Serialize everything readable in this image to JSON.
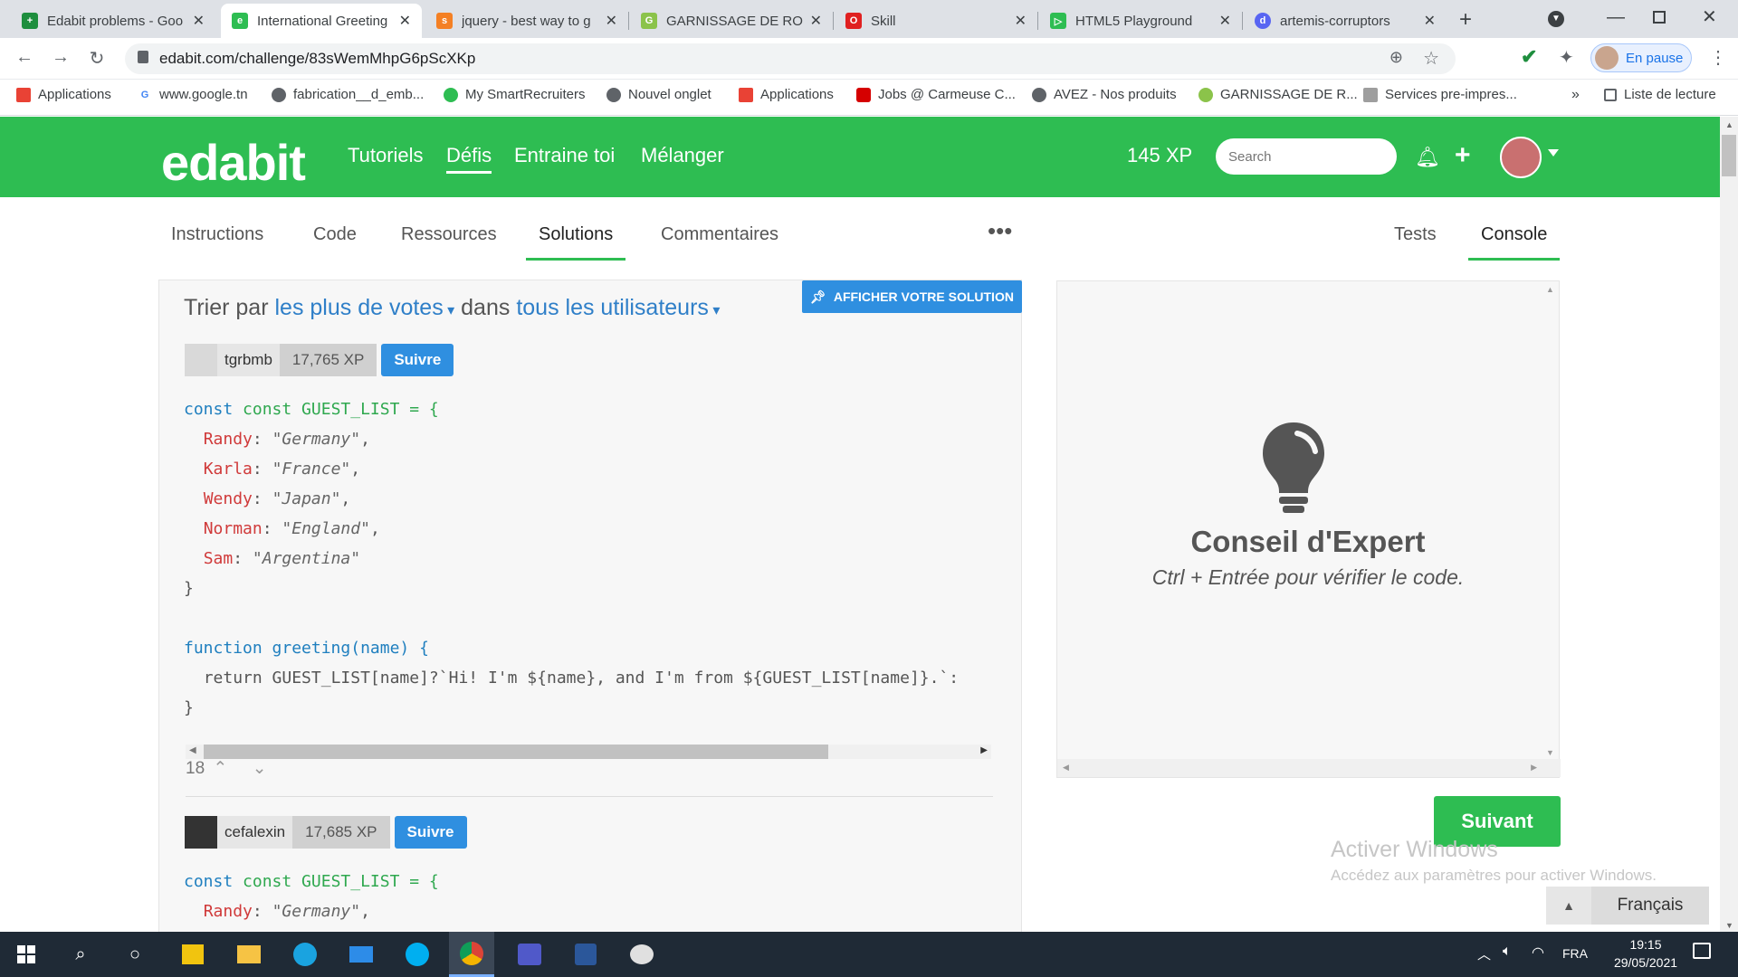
{
  "browser": {
    "tabs": [
      {
        "label": "Edabit problems - Goo",
        "favicon": "sheets-icon",
        "color": "#1e8e3e"
      },
      {
        "label": "International Greeting",
        "favicon": "edabit-icon",
        "color": "#2ebd52"
      },
      {
        "label": "jquery - best way to g",
        "favicon": "stackoverflow-icon",
        "color": "#f48024"
      },
      {
        "label": "GARNISSAGE DE ROU",
        "favicon": "garnissage-icon",
        "color": "#8bc34a"
      },
      {
        "label": "Skill",
        "favicon": "skill-icon",
        "color": "#e02020"
      },
      {
        "label": "HTML5 Playground",
        "favicon": "playground-icon",
        "color": "#2ebd52"
      },
      {
        "label": "artemis-corruptors",
        "favicon": "discord-icon",
        "color": "#5865f2"
      }
    ],
    "url": "edabit.com/challenge/83sWemMhpG6pScXKp",
    "profile_label": "En pause",
    "bookmarks": [
      {
        "label": "Applications",
        "icon": "apps-icon"
      },
      {
        "label": "www.google.tn",
        "icon": "google-icon"
      },
      {
        "label": "fabrication__d_emb...",
        "icon": "globe-icon"
      },
      {
        "label": "My SmartRecruiters",
        "icon": "smartrecruiters-icon"
      },
      {
        "label": "Nouvel onglet",
        "icon": "globe-icon"
      },
      {
        "label": "Applications",
        "icon": "apps-icon"
      },
      {
        "label": "Jobs @ Carmeuse C...",
        "icon": "carmeuse-icon"
      },
      {
        "label": "AVEZ - Nos produits",
        "icon": "globe-icon"
      },
      {
        "label": "GARNISSAGE DE R...",
        "icon": "garnissage-icon"
      },
      {
        "label": "Services pre-impres...",
        "icon": "services-icon"
      }
    ],
    "reading_list": "Liste de lecture"
  },
  "header": {
    "logo": "edabit",
    "nav": [
      "Tutoriels",
      "Défis",
      "Entraine toi",
      "Mélanger"
    ],
    "active_nav": "Défis",
    "xp": "145 XP",
    "search_placeholder": "Search"
  },
  "subtabs": {
    "left": [
      "Instructions",
      "Code",
      "Ressources",
      "Solutions",
      "Commentaires"
    ],
    "active_left": "Solutions",
    "right": [
      "Tests",
      "Console"
    ],
    "active_right": "Console"
  },
  "solutions": {
    "afficher": "AFFICHER VOTRE SOLUTION",
    "sort_prefix": "Trier par",
    "sort_value": "les plus de votes",
    "sort_mid": "dans",
    "sort_scope": "tous les utilisateurs",
    "items": [
      {
        "user": "tgrbmb",
        "xp": "17,765 XP",
        "follow": "Suivre",
        "votes": "18"
      },
      {
        "user": "cefalexin",
        "xp": "17,685 XP",
        "follow": "Suivre"
      }
    ],
    "code_line_1": "const GUEST_LIST = {",
    "code_randy": "Randy",
    "code_randy_v": "\"Germany\"",
    "code_karla": "Karla",
    "code_karla_v": "\"France\"",
    "code_wendy": "Wendy",
    "code_wendy_v": "\"Japan\"",
    "code_norman": "Norman",
    "code_norman_v": "\"England\"",
    "code_sam": "Sam",
    "code_sam_v": "\"Argentina\"",
    "code_close": "}",
    "code_fn": "function greeting(name) {",
    "code_return": "return GUEST_LIST[name]?`Hi! I'm ${name}, and I'm from ${GUEST_LIST[name]}.`:",
    "code_fn_close": "}"
  },
  "console": {
    "title": "Conseil d'Expert",
    "subtitle": "Ctrl + Entrée pour vérifier le code.",
    "next": "Suivant"
  },
  "windows": {
    "activate_title": "Activer Windows",
    "activate_sub": "Accédez aux paramètres pour activer Windows.",
    "language": "Français",
    "tray_lang": "FRA",
    "time": "19:15",
    "date": "29/05/2021"
  }
}
